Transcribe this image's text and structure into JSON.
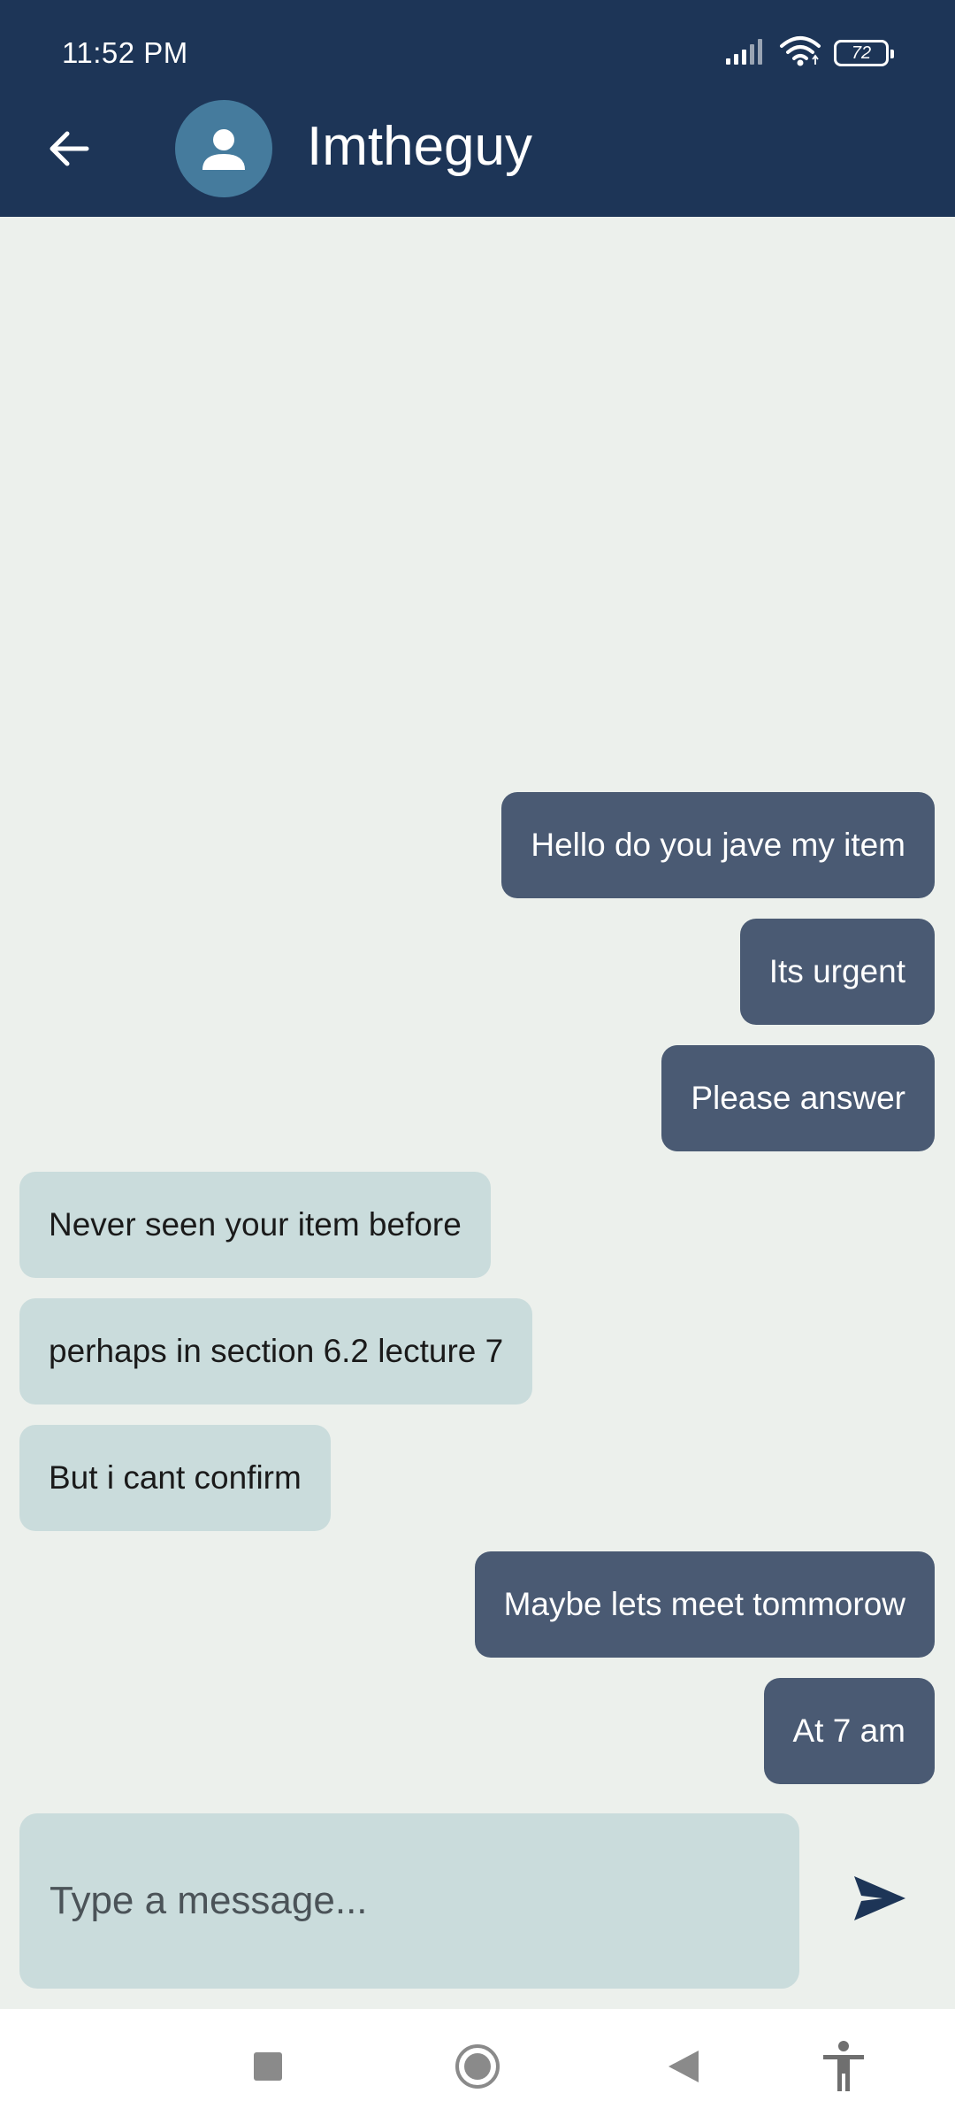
{
  "status_bar": {
    "time": "11:52 PM",
    "battery": "72",
    "icons": [
      "signal-icon",
      "wifi-icon",
      "battery-icon"
    ]
  },
  "header": {
    "contact_name": "Imtheguy",
    "back_icon": "arrow-left-icon",
    "avatar_icon": "person-icon"
  },
  "colors": {
    "header_bg": "#1d3557",
    "chat_bg": "#ecf0ec",
    "outgoing_bubble": "#4a5a73",
    "incoming_bubble": "#cadcdc",
    "avatar_bg": "#457b9d",
    "send_icon": "#1d3557"
  },
  "messages": [
    {
      "text": "Hello do you jave my item",
      "direction": "outgoing"
    },
    {
      "text": "Its urgent",
      "direction": "outgoing"
    },
    {
      "text": "Please answer",
      "direction": "outgoing"
    },
    {
      "text": "Never seen your item before",
      "direction": "incoming"
    },
    {
      "text": "perhaps in section 6.2 lecture 7",
      "direction": "incoming"
    },
    {
      "text": "But i cant confirm",
      "direction": "incoming"
    },
    {
      "text": "Maybe lets meet tommorow",
      "direction": "outgoing"
    },
    {
      "text": "At 7 am",
      "direction": "outgoing"
    }
  ],
  "composer": {
    "placeholder": "Type a message...",
    "value": "",
    "send_icon": "send-icon"
  },
  "nav_bar": {
    "icons": [
      "recents-square-icon",
      "home-circle-icon",
      "back-triangle-icon",
      "accessibility-icon"
    ]
  }
}
